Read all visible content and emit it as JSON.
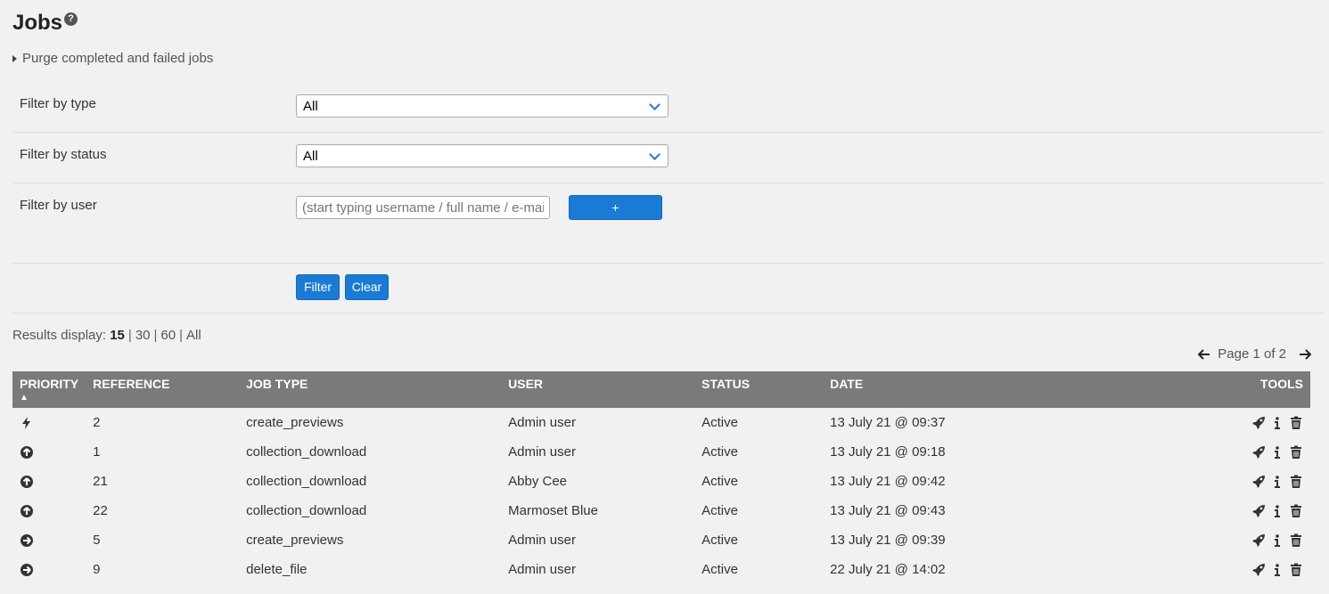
{
  "page": {
    "title": "Jobs",
    "help_glyph": "?"
  },
  "purge": {
    "label": "Purge completed and failed jobs"
  },
  "filters": {
    "type": {
      "label": "Filter by type",
      "value": "All"
    },
    "status": {
      "label": "Filter by status",
      "value": "All"
    },
    "user": {
      "label": "Filter by user",
      "placeholder": "(start typing username / full name / e-mail address)",
      "add_label": "+"
    },
    "filter_label": "Filter",
    "clear_label": "Clear"
  },
  "results": {
    "prefix": "Results display:",
    "current": "15",
    "opt_30": "30",
    "opt_60": "60",
    "opt_all": "All"
  },
  "pager": {
    "text": "Page 1 of 2"
  },
  "table": {
    "headers": {
      "priority": "PRIORITY",
      "sort": "▲",
      "reference": "REFERENCE",
      "job_type": "JOB TYPE",
      "user": "USER",
      "status": "STATUS",
      "date": "DATE",
      "tools": "TOOLS"
    },
    "rows": [
      {
        "priority_icon": "bolt-icon",
        "reference": "2",
        "job_type": "create_previews",
        "user": "Admin user",
        "status": "Active",
        "date": "13 July 21 @ 09:37"
      },
      {
        "priority_icon": "arrow-up-circle-icon",
        "reference": "1",
        "job_type": "collection_download",
        "user": "Admin user",
        "status": "Active",
        "date": "13 July 21 @ 09:18"
      },
      {
        "priority_icon": "arrow-up-circle-icon",
        "reference": "21",
        "job_type": "collection_download",
        "user": "Abby Cee",
        "status": "Active",
        "date": "13 July 21 @ 09:42"
      },
      {
        "priority_icon": "arrow-up-circle-icon",
        "reference": "22",
        "job_type": "collection_download",
        "user": "Marmoset Blue",
        "status": "Active",
        "date": "13 July 21 @ 09:43"
      },
      {
        "priority_icon": "arrow-right-circle-icon",
        "reference": "5",
        "job_type": "create_previews",
        "user": "Admin user",
        "status": "Active",
        "date": "13 July 21 @ 09:39"
      },
      {
        "priority_icon": "arrow-right-circle-icon",
        "reference": "9",
        "job_type": "delete_file",
        "user": "Admin user",
        "status": "Active",
        "date": "22 July 21 @ 14:02"
      }
    ]
  },
  "colors": {
    "accent": "#1a7bd6",
    "header_bg": "#7a7a7a",
    "page_bg": "#f1f1f1"
  }
}
